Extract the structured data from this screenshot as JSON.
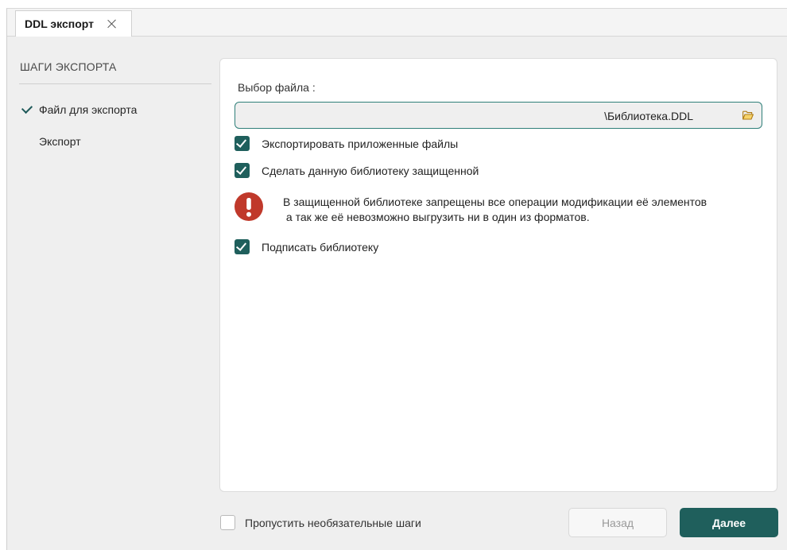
{
  "tab": {
    "title": "DDL экспорт",
    "close_icon": "close-icon"
  },
  "steps": {
    "title": "ШАГИ ЭКСПОРТА",
    "items": [
      {
        "label": "Файл для экспорта",
        "done": true
      },
      {
        "label": "Экспорт",
        "done": false
      }
    ]
  },
  "file": {
    "label": "Выбор файла :",
    "value": "\\Библиотека.DDL",
    "browse_icon": "folder-open-icon"
  },
  "options": {
    "export_attached": {
      "label": "Экспортировать приложенные файлы",
      "checked": true
    },
    "protect_library": {
      "label": "Сделать данную библиотеку защищенной",
      "checked": true
    },
    "sign_library": {
      "label": "Подписать библиотеку",
      "checked": true
    }
  },
  "warning": {
    "icon": "exclamation-icon",
    "line1": "В защищенной библиотеке запрещены все операции модификации её элементов",
    "line2": " а так же её невозможно выгрузить ни в один из форматов."
  },
  "footer": {
    "skip_optional": {
      "label": "Пропустить необязательные шаги",
      "checked": false
    },
    "back_label": "Назад",
    "next_label": "Далее"
  },
  "colors": {
    "accent": "#1f5f5c",
    "warning": "#c0392b",
    "input_border": "#2f7f79"
  }
}
